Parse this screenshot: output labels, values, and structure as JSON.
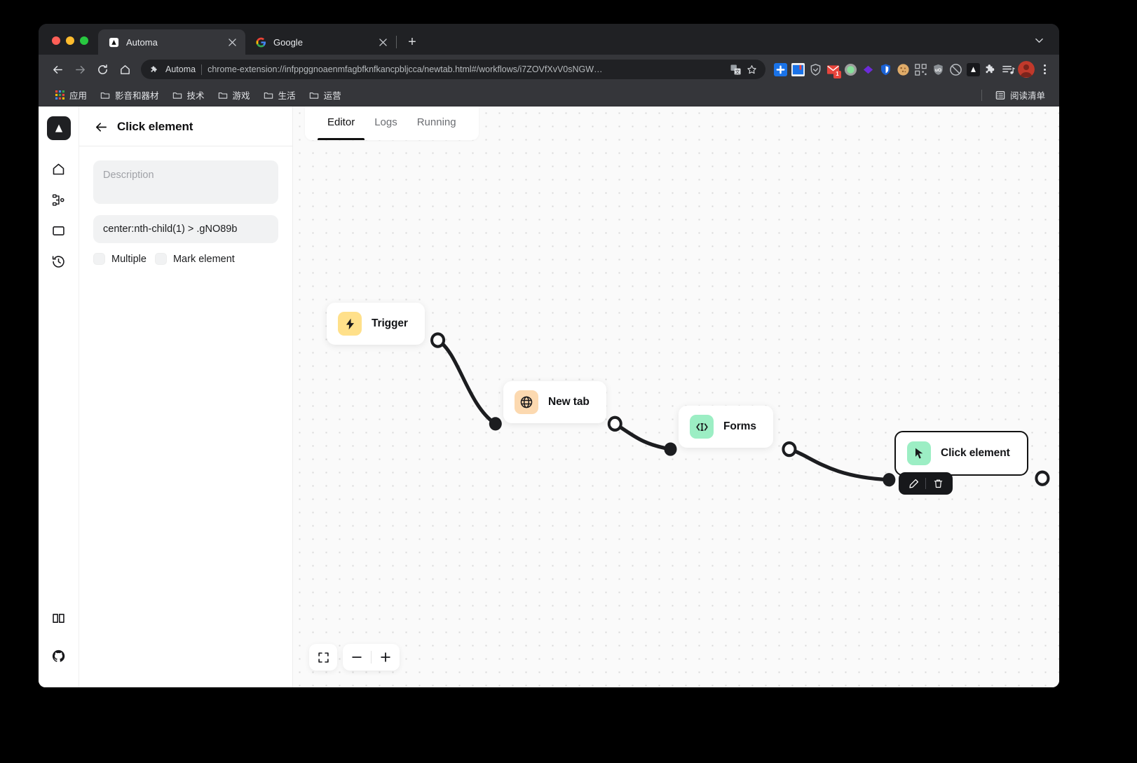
{
  "browser": {
    "tabs": [
      {
        "title": "Automa",
        "favicon": "automa-icon",
        "active": true
      },
      {
        "title": "Google",
        "favicon": "google-icon",
        "active": false
      }
    ],
    "newtab_label": "+",
    "window_caret": "chevron-down-icon",
    "toolbar": {
      "back": "back-arrow-icon",
      "forward": "forward-arrow-icon",
      "reload": "reload-icon",
      "home": "home-icon",
      "omnibox": {
        "extension_name": "Automa",
        "extension_icon": "puzzle-piece-icon",
        "url": "chrome-extension://infppggnoaenmfagbfknfkancpbljcca/newtab.html#/workflows/i7ZOVfXvV0sNGW…",
        "translate_icon": "translate-icon",
        "bookmark_icon": "star-icon"
      },
      "extensions": [
        "blue-plus-icon",
        "blue-book-icon",
        "shield-check-icon",
        "mail-icon",
        "green-circle-icon",
        "purple-diamond-icon",
        "blue-shield-icon",
        "cookie-icon",
        "qrcode-icon",
        "ublock-icon",
        "blocker-icon",
        "automa-icon",
        "puzzle-piece-icon",
        "playlist-icon"
      ],
      "mail_badge": "1",
      "avatar": "user-avatar",
      "menu": "three-dot-menu-icon"
    },
    "bookmarks": {
      "items": [
        {
          "label": "应用",
          "icon": "apps-grid-icon"
        },
        {
          "label": "影音和器材",
          "icon": "folder-icon"
        },
        {
          "label": "技术",
          "icon": "folder-icon"
        },
        {
          "label": "游戏",
          "icon": "folder-icon"
        },
        {
          "label": "生活",
          "icon": "folder-icon"
        },
        {
          "label": "运营",
          "icon": "folder-icon"
        }
      ],
      "reading_list_label": "阅读清单",
      "reading_list_icon": "reading-list-icon"
    }
  },
  "app": {
    "rail": [
      {
        "name": "logo",
        "icon": "automa-logo-icon"
      },
      {
        "name": "dashboard",
        "icon": "home-icon"
      },
      {
        "name": "workflows",
        "icon": "sitemap-icon"
      },
      {
        "name": "storage",
        "icon": "folder-icon"
      },
      {
        "name": "logs",
        "icon": "history-clock-icon"
      },
      {
        "name": "docs",
        "icon": "book-icon"
      },
      {
        "name": "github",
        "icon": "github-icon"
      }
    ],
    "panel": {
      "back_icon": "back-arrow-icon",
      "title": "Click element",
      "description_placeholder": "Description",
      "selector_value": "center:nth-child(1) > .gNO89b",
      "checkboxes": [
        {
          "label": "Multiple",
          "checked": false
        },
        {
          "label": "Mark element",
          "checked": false
        }
      ]
    },
    "editor": {
      "tabs": [
        {
          "label": "Editor",
          "active": true
        },
        {
          "label": "Logs",
          "active": false
        },
        {
          "label": "Running",
          "active": false
        }
      ],
      "nodes": [
        {
          "label": "Trigger",
          "icon": "lightning-bolt-icon",
          "icon_bg": "#ffe08a",
          "selected": false
        },
        {
          "label": "New tab",
          "icon": "globe-icon",
          "icon_bg": "#fcd9b0",
          "selected": false
        },
        {
          "label": "Forms",
          "icon": "code-cursor-icon",
          "icon_bg": "#9ceec4",
          "selected": false
        },
        {
          "label": "Click element",
          "icon": "mouse-pointer-icon",
          "icon_bg": "#9ceec4",
          "selected": true
        }
      ],
      "node_toolbar": [
        {
          "name": "edit",
          "icon": "pencil-icon"
        },
        {
          "name": "delete",
          "icon": "trash-icon"
        }
      ],
      "zoom_controls": [
        {
          "name": "fit-view",
          "icon": "expand-icon"
        },
        {
          "name": "zoom-out",
          "icon": "minus-icon"
        },
        {
          "name": "zoom-in",
          "icon": "plus-icon"
        }
      ]
    }
  },
  "colors": {
    "accent_yellow": "#ffe08a",
    "accent_orange": "#fcd9b0",
    "accent_green": "#9ceec4",
    "node_border": "#121212",
    "canvas_bg": "#fafafa"
  }
}
